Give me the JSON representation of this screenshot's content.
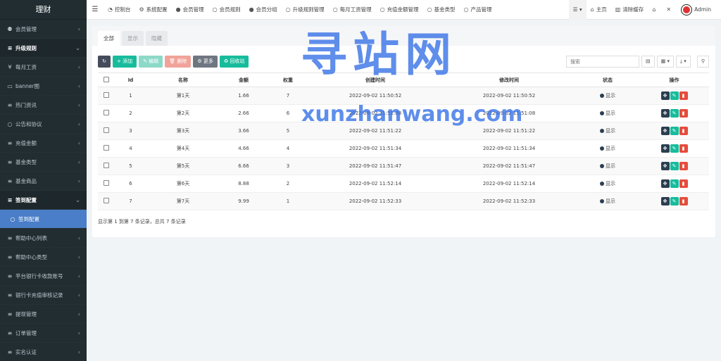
{
  "sidebar": {
    "logo": "理财",
    "items": [
      {
        "label": "会员管理",
        "icon": "user-circle-icon",
        "glyph": "⚉",
        "type": "normal"
      },
      {
        "label": "升级规则",
        "icon": "list-icon",
        "glyph": "≡",
        "type": "section"
      },
      {
        "label": "每月工资",
        "icon": "yen-icon",
        "glyph": "¥",
        "type": "normal"
      },
      {
        "label": "banner图",
        "icon": "image-icon",
        "glyph": "▭",
        "type": "normal"
      },
      {
        "label": "热门资讯",
        "icon": "list-icon",
        "glyph": "≡",
        "type": "normal"
      },
      {
        "label": "公告和协议",
        "icon": "circle-icon",
        "glyph": "○",
        "type": "normal"
      },
      {
        "label": "充值金额",
        "icon": "list-icon",
        "glyph": "≡",
        "type": "normal"
      },
      {
        "label": "基金类型",
        "icon": "list-icon",
        "glyph": "≡",
        "type": "normal"
      },
      {
        "label": "基金商品",
        "icon": "list-icon",
        "glyph": "≡",
        "type": "normal"
      },
      {
        "label": "签到配置",
        "icon": "list-icon",
        "glyph": "≡",
        "type": "section"
      },
      {
        "label": "签到配置",
        "icon": "circle-icon",
        "glyph": "○",
        "type": "active"
      },
      {
        "label": "帮助中心列表",
        "icon": "list-icon",
        "glyph": "≡",
        "type": "normal"
      },
      {
        "label": "帮助中心类型",
        "icon": "list-icon",
        "glyph": "≡",
        "type": "normal"
      },
      {
        "label": "平台银行卡收款账号",
        "icon": "list-icon",
        "glyph": "≡",
        "type": "normal"
      },
      {
        "label": "银行卡充值审核记录",
        "icon": "list-icon",
        "glyph": "≡",
        "type": "normal"
      },
      {
        "label": "提现管理",
        "icon": "list-icon",
        "glyph": "≡",
        "type": "normal"
      },
      {
        "label": "订单管理",
        "icon": "list-icon",
        "glyph": "≡",
        "type": "normal"
      },
      {
        "label": "实名认证",
        "icon": "list-icon",
        "glyph": "≡",
        "type": "normal"
      }
    ]
  },
  "topbar": {
    "items": [
      {
        "label": "控制台",
        "icon": "dashboard-icon",
        "glyph": "◔"
      },
      {
        "label": "系统配置",
        "icon": "gear-icon",
        "glyph": "⚙"
      },
      {
        "label": "会员管理",
        "icon": "user-icon",
        "glyph": "●"
      },
      {
        "label": "会员规则",
        "icon": "circle-icon",
        "glyph": "○"
      },
      {
        "label": "会员分组",
        "icon": "users-icon",
        "glyph": "●"
      },
      {
        "label": "升级规则管理",
        "icon": "circle-icon",
        "glyph": "○"
      },
      {
        "label": "每月工资管理",
        "icon": "circle-icon",
        "glyph": "○"
      },
      {
        "label": "充值金额管理",
        "icon": "circle-icon",
        "glyph": "○"
      },
      {
        "label": "基金类型",
        "icon": "circle-icon",
        "glyph": "○"
      },
      {
        "label": "产品管理",
        "icon": "circle-icon",
        "glyph": "○"
      }
    ],
    "home": "主页",
    "clear_cache": "清除缓存",
    "user": "Admin"
  },
  "tabs": [
    "全部",
    "显示",
    "隐藏"
  ],
  "toolbar": {
    "refresh": "↻",
    "add": "+ 添加",
    "edit": "✎ 编辑",
    "delete": "🗑 删除",
    "more": "⚙ 更多",
    "recycle": "♻ 回收站"
  },
  "search": {
    "placeholder": "搜索"
  },
  "table": {
    "headers": [
      "Id",
      "名称",
      "金额",
      "权重",
      "创建时间",
      "修改时间",
      "状态",
      "操作"
    ],
    "rows": [
      {
        "id": "1",
        "name": "第1天",
        "amount": "1.66",
        "weight": "7",
        "created": "2022-09-02 11:50:52",
        "updated": "2022-09-02 11:50:52",
        "status": "显示"
      },
      {
        "id": "2",
        "name": "第2天",
        "amount": "2.66",
        "weight": "6",
        "created": "2022-09-02 11:51:08",
        "updated": "2022-09-02 11:51:08",
        "status": "显示"
      },
      {
        "id": "3",
        "name": "第3天",
        "amount": "3.66",
        "weight": "5",
        "created": "2022-09-02 11:51:22",
        "updated": "2022-09-02 11:51:22",
        "status": "显示"
      },
      {
        "id": "4",
        "name": "第4天",
        "amount": "4.66",
        "weight": "4",
        "created": "2022-09-02 11:51:34",
        "updated": "2022-09-02 11:51:34",
        "status": "显示"
      },
      {
        "id": "5",
        "name": "第5天",
        "amount": "6.66",
        "weight": "3",
        "created": "2022-09-02 11:51:47",
        "updated": "2022-09-02 11:51:47",
        "status": "显示"
      },
      {
        "id": "6",
        "name": "第6天",
        "amount": "8.88",
        "weight": "2",
        "created": "2022-09-02 11:52:14",
        "updated": "2022-09-02 11:52:14",
        "status": "显示"
      },
      {
        "id": "7",
        "name": "第7天",
        "amount": "9.99",
        "weight": "1",
        "created": "2022-09-02 11:52:33",
        "updated": "2022-09-02 11:52:33",
        "status": "显示"
      }
    ]
  },
  "footer": "显示第 1 到第 7 条记录，总共 7 条记录",
  "watermark": {
    "line1": "寻站网",
    "line2": "xunzhanwang.com"
  }
}
